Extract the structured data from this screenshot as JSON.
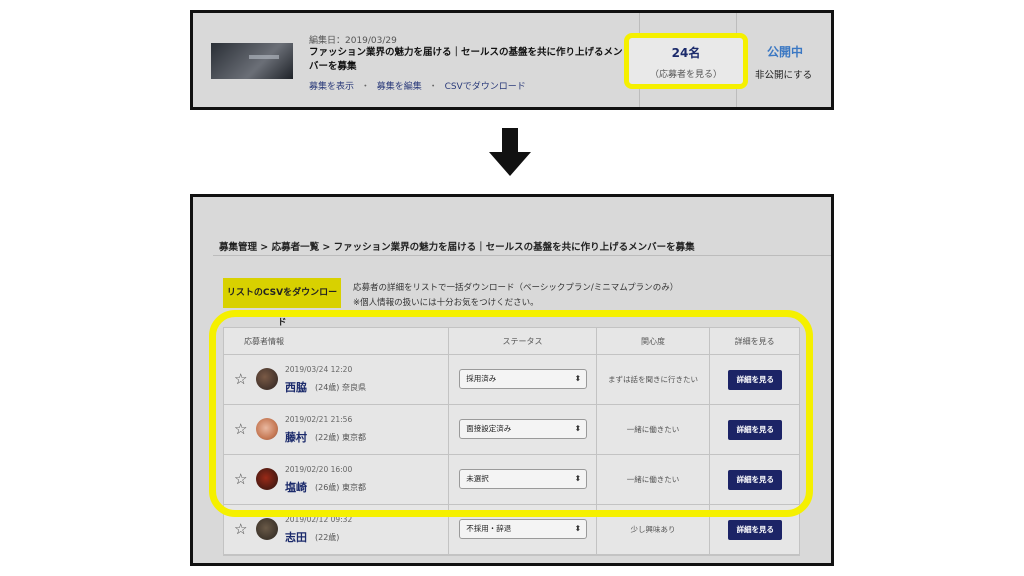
{
  "top": {
    "edit_date": "編集日：2019/03/29",
    "job_title": "ファッション業界の魅力を届ける｜セールスの基盤を共に作り上げるメンバーを募集",
    "links": [
      "募集を表示",
      "募集を編集",
      "CSVでダウンロード"
    ],
    "link_sep": "・",
    "applicant_count": "24名",
    "applicant_view": "（応募者を見る）",
    "status": "公開中",
    "unpublish": "非公開にする"
  },
  "bottom": {
    "breadcrumb": "募集管理 > 応募者一覧 > ファッション業界の魅力を届ける｜セールスの基盤を共に作り上げるメンバーを募集",
    "csv_button": "リストのCSVをダウンロード",
    "csv_note_1": "応募者の詳細をリストで一括ダウンロード（ベーシックプラン/ミニマムプランのみ）",
    "csv_note_2": "※個人情報の扱いには十分お気をつけください。",
    "table": {
      "headers": [
        "応募者情報",
        "ステータス",
        "関心度",
        "詳細を見る"
      ],
      "rows": [
        {
          "date": "2019/03/24 12:20",
          "name": "西脇",
          "age_loc": "(24歳)  奈良県",
          "status": "採用済み",
          "interest": "まずは話を聞きに行きたい",
          "detail": "詳細を見る"
        },
        {
          "date": "2019/02/21 21:56",
          "name": "藤村",
          "age_loc": "(22歳)  東京都",
          "status": "面接設定済み",
          "interest": "一緒に働きたい",
          "detail": "詳細を見る"
        },
        {
          "date": "2019/02/20 16:00",
          "name": "塩崎",
          "age_loc": "(26歳)  東京都",
          "status": "未選択",
          "interest": "一緒に働きたい",
          "detail": "詳細を見る"
        },
        {
          "date": "2019/02/12 09:32",
          "name": "志田",
          "age_loc": "(22歳)",
          "status": "不採用・辞退",
          "interest": "少し興味あり",
          "detail": "詳細を見る"
        }
      ]
    }
  },
  "colors": {
    "highlight": "#f5f000",
    "navy": "#1c2466",
    "csv_yellow": "#d8d100",
    "published_blue": "#3b78c3"
  },
  "icons": [
    "down-arrow-icon",
    "star-icon",
    "select-arrow-icon"
  ]
}
